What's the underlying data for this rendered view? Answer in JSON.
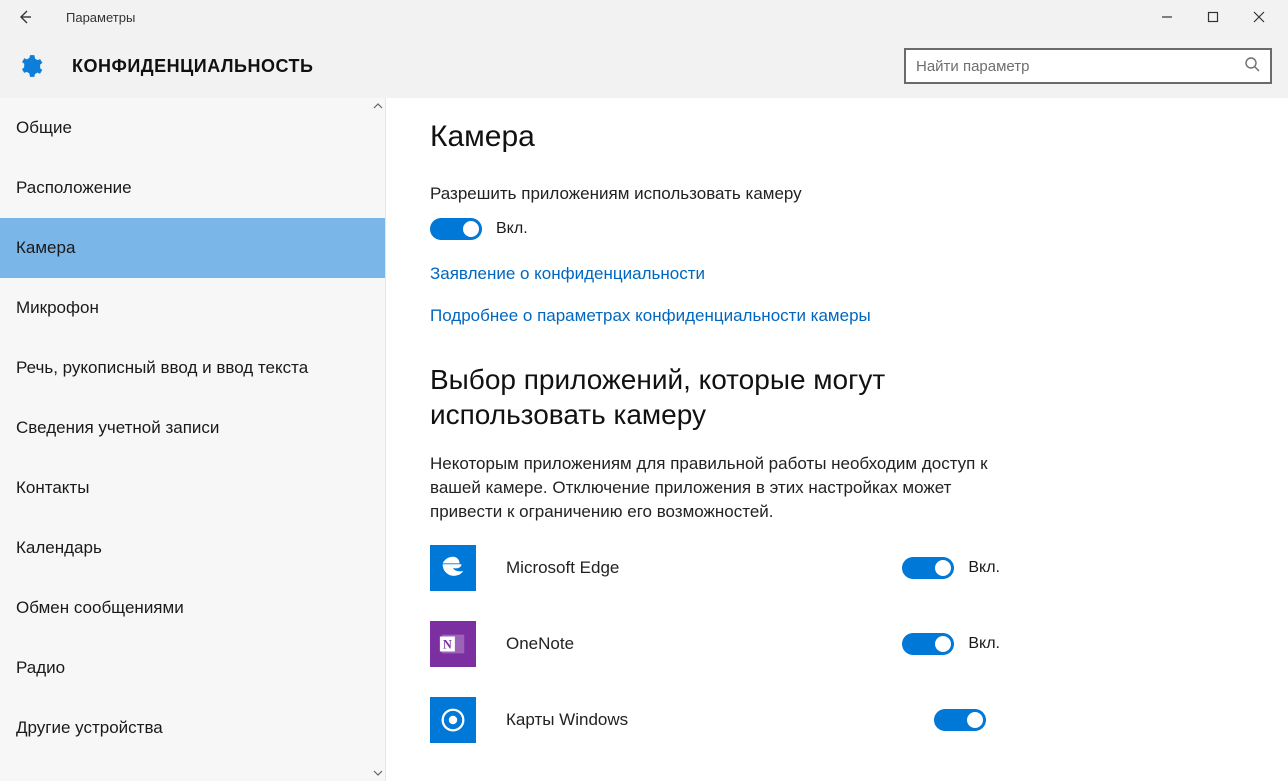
{
  "window": {
    "title": "Параметры"
  },
  "header": {
    "category": "КОНФИДЕНЦИАЛЬНОСТЬ",
    "search_placeholder": "Найти параметр"
  },
  "sidebar": {
    "items": [
      {
        "label": "Общие"
      },
      {
        "label": "Расположение"
      },
      {
        "label": "Камера"
      },
      {
        "label": "Микрофон"
      },
      {
        "label": "Речь, рукописный ввод и ввод текста"
      },
      {
        "label": "Сведения учетной записи"
      },
      {
        "label": "Контакты"
      },
      {
        "label": "Календарь"
      },
      {
        "label": "Обмен сообщениями"
      },
      {
        "label": "Радио"
      },
      {
        "label": "Другие устройства"
      }
    ],
    "selected_index": 2
  },
  "main": {
    "page_title": "Камера",
    "allow_label": "Разрешить приложениям использовать камеру",
    "allow_state_text": "Вкл.",
    "link_privacy_statement": "Заявление о конфиденциальности",
    "link_more_camera_privacy": "Подробнее о параметрах конфиденциальности камеры",
    "choose_apps_heading": "Выбор приложений, которые могут использовать камеру",
    "choose_apps_desc": "Некоторым приложениям для правильной работы необходим доступ к вашей камере. Отключение приложения в этих настройках может привести к ограничению его возможностей.",
    "apps": [
      {
        "name": "Microsoft Edge",
        "state_text": "Вкл.",
        "icon": "edge",
        "icon_bg": "#0078d7"
      },
      {
        "name": "OneNote",
        "state_text": "Вкл.",
        "icon": "onenote",
        "icon_bg": "#7b2fa0"
      },
      {
        "name": "Карты Windows",
        "state_text": "",
        "icon": "maps",
        "icon_bg": "#0078d7"
      }
    ]
  },
  "colors": {
    "accent": "#0078d7",
    "sidebar_selected": "#7bb6e8",
    "link": "#0067c0",
    "header_bg": "#f2f2f2"
  }
}
